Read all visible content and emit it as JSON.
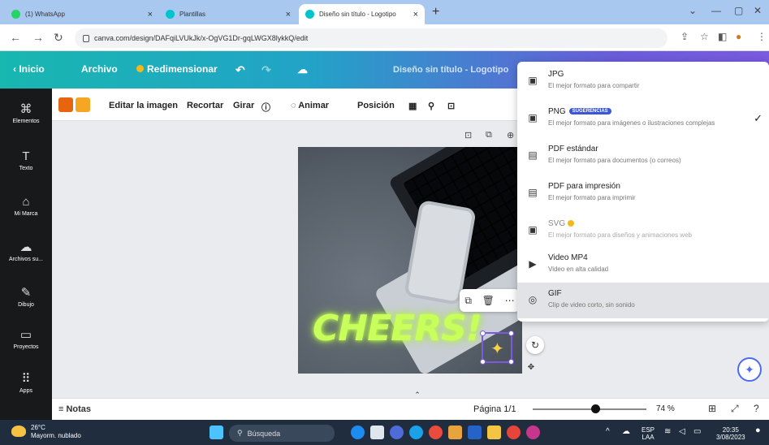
{
  "browser": {
    "tabs": [
      {
        "title": "(1) WhatsApp",
        "color": "#25d366"
      },
      {
        "title": "Plantillas",
        "color": "#00c4cc"
      },
      {
        "title": "Diseño sin título - Logotipo",
        "color": "#00c4cc"
      }
    ],
    "new_tab": "+",
    "url": "canva.com/design/DAFqiLVUkJk/x-OgVG1Dr-gqLWGX8lykkQ/edit"
  },
  "topbar": {
    "home": "Inicio",
    "file": "Archivo",
    "resize": "Redimensionar",
    "title": "Diseño sin título - Logotipo"
  },
  "sidebar": {
    "items": [
      {
        "label": "Elementos",
        "icon": "elements-icon",
        "glyph": "⌘"
      },
      {
        "label": "Texto",
        "icon": "text-icon",
        "glyph": "T"
      },
      {
        "label": "Mi Marca",
        "icon": "brand-icon",
        "glyph": "⌂"
      },
      {
        "label": "Archivos su...",
        "icon": "upload-icon",
        "glyph": "☁"
      },
      {
        "label": "Dibujo",
        "icon": "draw-icon",
        "glyph": "✎"
      },
      {
        "label": "Proyectos",
        "icon": "folder-icon",
        "glyph": "▭"
      },
      {
        "label": "Apps",
        "icon": "apps-icon",
        "glyph": "⠿"
      }
    ]
  },
  "edit_toolbar": {
    "colors": [
      "#e8650f",
      "#f5a623"
    ],
    "edit_image": "Editar la imagen",
    "crop": "Recortar",
    "flip": "Girar",
    "animate": "Animar",
    "position": "Posición"
  },
  "canvas": {
    "headline": "CHEERS!"
  },
  "bottom": {
    "notes": "Notas",
    "page": "Página 1/1",
    "zoom": "74 %"
  },
  "download_menu": {
    "options": [
      {
        "title": "JPG",
        "desc": "El mejor formato para compartir",
        "icon": "image-icon",
        "glyph": "▣"
      },
      {
        "title": "PNG",
        "badge": "SUGERENCIAS",
        "desc": "El mejor formato para imágenes o ilustraciones complejas",
        "icon": "image-icon",
        "glyph": "▣",
        "checked": true
      },
      {
        "title": "PDF estándar",
        "desc": "El mejor formato para documentos (o correos)",
        "icon": "document-icon",
        "glyph": "▤"
      },
      {
        "title": "PDF para impresión",
        "desc": "El mejor formato para imprimir",
        "icon": "document-icon",
        "glyph": "▤"
      },
      {
        "title": "SVG",
        "desc": "El mejor formato para diseños y animaciones web",
        "icon": "image-icon",
        "glyph": "▣",
        "premium": true
      },
      {
        "title": "Video MP4",
        "desc": "Video en alta calidad",
        "icon": "video-icon",
        "glyph": "▶"
      },
      {
        "title": "GIF",
        "desc": "Clip de video corto, sin sonido",
        "icon": "gif-icon",
        "glyph": "◎",
        "selected": true
      }
    ],
    "check": "✓"
  },
  "taskbar": {
    "temp": "26°C",
    "weather": "Mayorm. nublado",
    "search": "Búsqueda",
    "lang1": "ESP",
    "lang2": "LAA",
    "time": "20:35",
    "date": "3/08/2023"
  }
}
